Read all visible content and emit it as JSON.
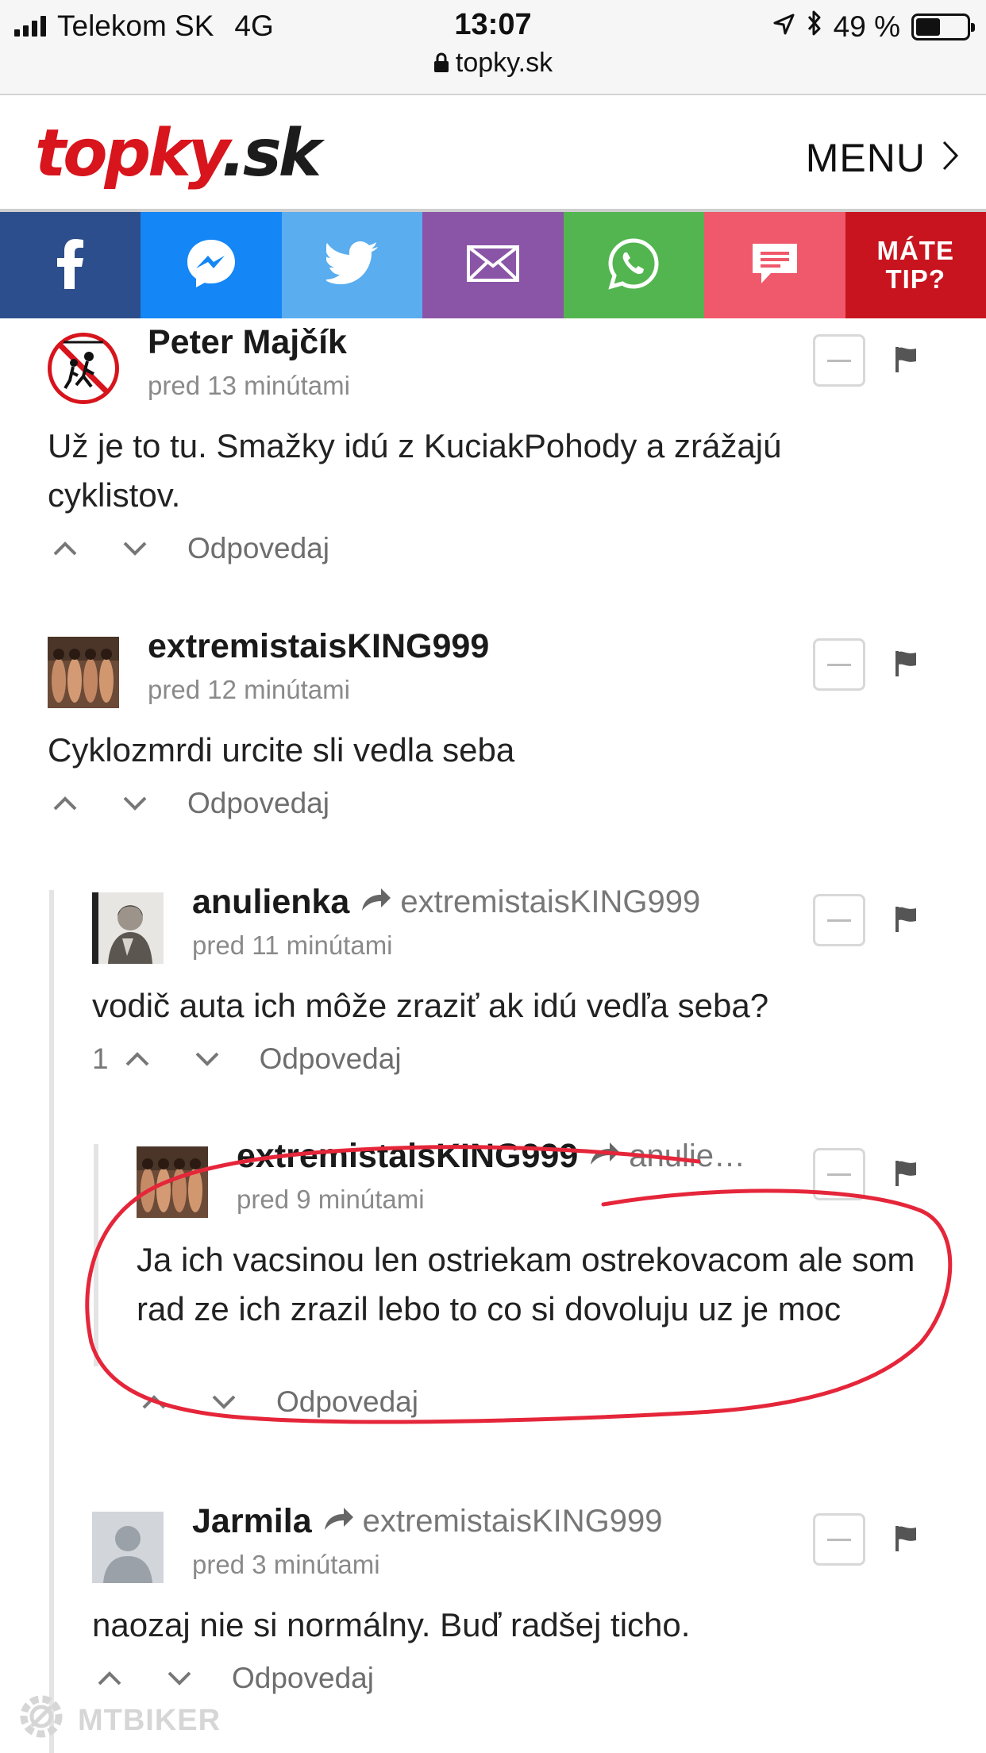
{
  "status": {
    "carrier": "Telekom SK",
    "network": "4G",
    "time": "13:07",
    "url": "topky.sk",
    "battery": "49 %",
    "battery_level": 0.49
  },
  "header": {
    "logo_red": "topky",
    "logo_dark": ".sk",
    "menu_label": "MENU"
  },
  "share": {
    "tip_line1": "MÁTE",
    "tip_line2": "TIP?",
    "icons": [
      "facebook-icon",
      "messenger-icon",
      "twitter-icon",
      "email-icon",
      "whatsapp-icon",
      "comment-icon"
    ]
  },
  "comments": [
    {
      "author": "Peter Majčík",
      "time": "pred 13 minútami",
      "text": "Už je to tu. Smažky idú z KuciakPohody a zrážajú cyklistov.",
      "reply_label": "Odpovedaj"
    },
    {
      "author": "extremistaisKING999",
      "time": "pred 12 minútami",
      "text": "Cyklozmrdi urcite sli vedla seba",
      "reply_label": "Odpovedaj"
    },
    {
      "author": "anulienka",
      "reply_to": "extremistaisKING999",
      "time": "pred 11 minútami",
      "text": "vodič auta ich môže zraziť ak idú vedľa seba?",
      "votes": "1",
      "reply_label": "Odpovedaj"
    },
    {
      "author": "extremistaisKING999",
      "reply_to": "anulie…",
      "time": "pred 9 minútami",
      "text": "Ja ich vacsinou len ostriekam ostrekovacom ale som rad ze ich zrazil lebo to co si dovoluju uz je moc",
      "reply_label": "Odpovedaj"
    },
    {
      "author": "Jarmila",
      "reply_to": "extremistaisKING999",
      "time": "pred 3 minútami",
      "text": "naozaj nie si normálny. Buď radšej ticho.",
      "reply_label": "Odpovedaj"
    }
  ],
  "watermark": "MTBIKER",
  "colors": {
    "facebook": "#2d4e8c",
    "messenger": "#1486f5",
    "twitter": "#5aadee",
    "email": "#8a55a6",
    "whatsapp": "#53b54f",
    "comment": "#f0586b",
    "tip": "#c8141f",
    "logo_red": "#d8141c",
    "annotation_circle": "#e5263a"
  }
}
